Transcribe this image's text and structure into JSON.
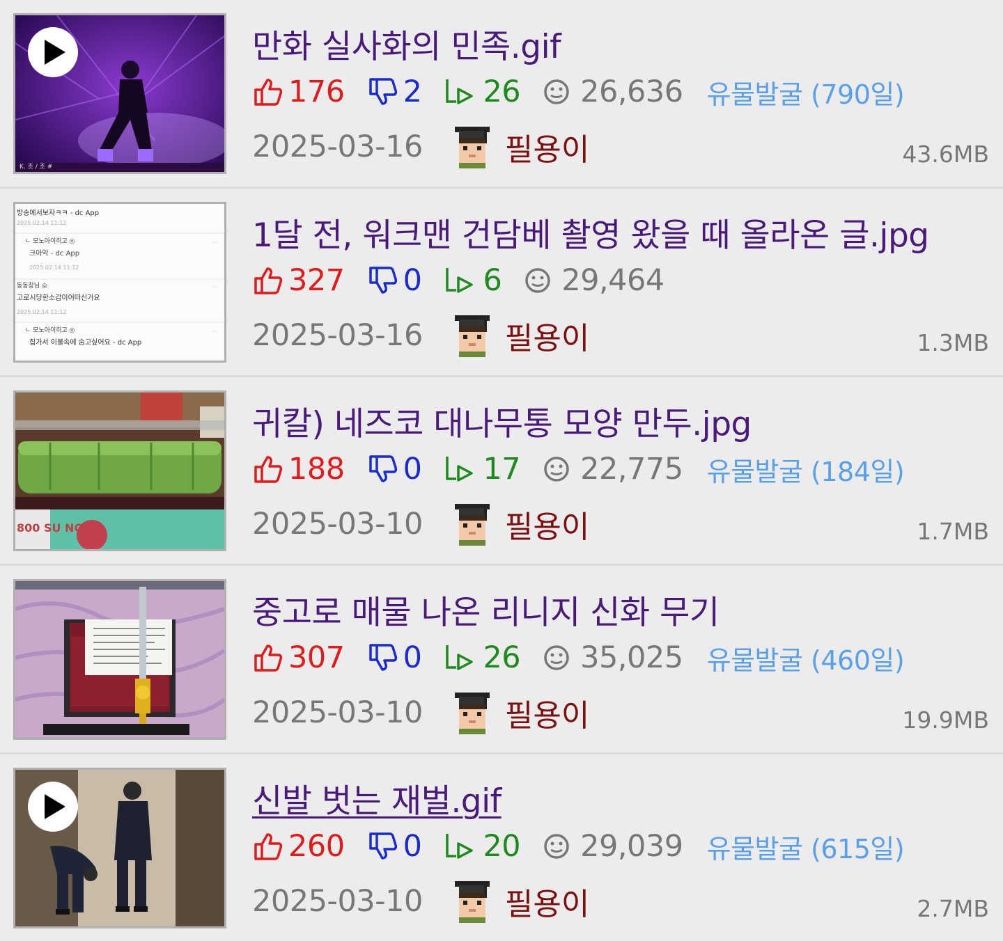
{
  "posts": [
    {
      "title": "만화 실사화의 민족.gif",
      "likes": "176",
      "dislikes": "2",
      "replies": "26",
      "views": "26,636",
      "badge": "유물발굴 (790일)",
      "date": "2025-03-16",
      "author": "필용이",
      "size": "43.6MB",
      "has_play": true,
      "visited": false,
      "thumb_theme": "purple-stage",
      "thumb_text": "K. 조 / 조 #"
    },
    {
      "title": "1달 전, 워크맨 건담베 촬영 왔을 때 올라온 글.jpg",
      "likes": "327",
      "dislikes": "0",
      "replies": "6",
      "views": "29,464",
      "badge": "",
      "date": "2025-03-16",
      "author": "필용이",
      "size": "1.3MB",
      "has_play": false,
      "visited": false,
      "thumb_theme": "comment-screenshot",
      "thumb_lines": [
        "방송에서보자ㅋㅋ - dc App",
        "2025.02.14 11:12",
        "ㄴ 모노아이히고 ◎",
        "크아악 - dc App",
        "2025.02.14 11:12",
        "동동창님 ◎",
        "고로시당한소감이어떠신가요",
        "2025.02.14 11:12",
        "ㄴ 모노아이히고 ◎",
        "집가서 이불속에 숨고싶어요 - dc App"
      ]
    },
    {
      "title": "귀칼) 네즈코 대나무통 모양 만두.jpg",
      "likes": "188",
      "dislikes": "0",
      "replies": "17",
      "views": "22,775",
      "badge": "유물발굴 (184일)",
      "date": "2025-03-10",
      "author": "필용이",
      "size": "1.7MB",
      "has_play": false,
      "visited": false,
      "thumb_theme": "green-food",
      "thumb_text": "800 SU NO"
    },
    {
      "title": "중고로 매물 나온 리니지 신화 무기",
      "likes": "307",
      "dislikes": "0",
      "replies": "26",
      "views": "35,025",
      "badge": "유물발굴 (460일)",
      "date": "2025-03-10",
      "author": "필용이",
      "size": "19.9MB",
      "has_play": false,
      "visited": false,
      "thumb_theme": "weapon-case"
    },
    {
      "title": "신발 벗는 재벌.gif",
      "likes": "260",
      "dislikes": "0",
      "replies": "20",
      "views": "29,039",
      "badge": "유물발굴 (615일)",
      "date": "2025-03-10",
      "author": "필용이",
      "size": "2.7MB",
      "has_play": true,
      "visited": true,
      "thumb_theme": "hallway"
    }
  ],
  "colors": {
    "title": "#4a1a7a",
    "like": "#e01b1b",
    "dislike": "#1a2ccc",
    "reply": "#1c8a1c",
    "view": "#777777",
    "badge": "#5aa0e8",
    "author": "#7a1010"
  },
  "icons": {
    "like": "thumbs-up-icon",
    "dislike": "thumbs-down-icon",
    "reply": "reply-arrow-icon",
    "view": "smiley-face-icon",
    "author": "graduate-avatar-icon",
    "play": "play-icon"
  }
}
